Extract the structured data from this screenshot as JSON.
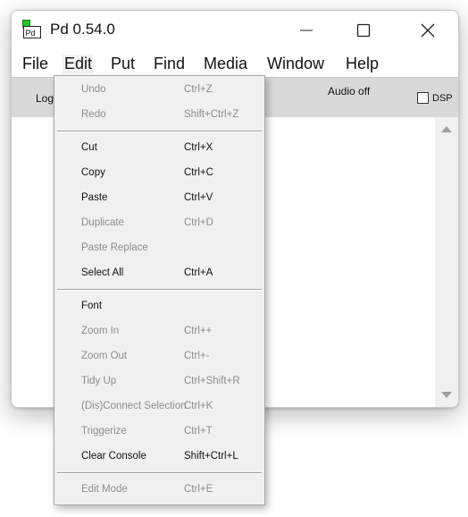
{
  "window": {
    "title": "Pd 0.54.0",
    "icon_text": "Pd",
    "controls": [
      "minimize-icon",
      "maximize-icon",
      "close-icon"
    ]
  },
  "menubar": {
    "items": [
      "File",
      "Edit",
      "Put",
      "Find",
      "Media",
      "Window",
      "Help"
    ],
    "active": "Edit"
  },
  "toolbar": {
    "log_label": "Log:",
    "audio_status": "Audio off",
    "dsp_label": "DSP",
    "dsp_checked": false
  },
  "edit_menu": {
    "items": [
      {
        "label": "Undo",
        "shortcut": "Ctrl+Z",
        "enabled": false
      },
      {
        "label": "Redo",
        "shortcut": "Shift+Ctrl+Z",
        "enabled": false
      },
      {
        "label": "Cut",
        "shortcut": "Ctrl+X",
        "enabled": true
      },
      {
        "label": "Copy",
        "shortcut": "Ctrl+C",
        "enabled": true
      },
      {
        "label": "Paste",
        "shortcut": "Ctrl+V",
        "enabled": true
      },
      {
        "label": "Duplicate",
        "shortcut": "Ctrl+D",
        "enabled": false
      },
      {
        "label": "Paste Replace",
        "shortcut": "",
        "enabled": false
      },
      {
        "label": "Select All",
        "shortcut": "Ctrl+A",
        "enabled": true
      },
      {
        "label": "Font",
        "shortcut": "",
        "enabled": true
      },
      {
        "label": "Zoom In",
        "shortcut": "Ctrl++",
        "enabled": false
      },
      {
        "label": "Zoom Out",
        "shortcut": "Ctrl+-",
        "enabled": false
      },
      {
        "label": "Tidy Up",
        "shortcut": "Ctrl+Shift+R",
        "enabled": false
      },
      {
        "label": "(Dis)Connect Selection",
        "shortcut": "Ctrl+K",
        "enabled": false
      },
      {
        "label": "Triggerize",
        "shortcut": "Ctrl+T",
        "enabled": false
      },
      {
        "label": "Clear Console",
        "shortcut": "Shift+Ctrl+L",
        "enabled": true
      },
      {
        "label": "Edit Mode",
        "shortcut": "Ctrl+E",
        "enabled": false
      }
    ]
  },
  "colors": {
    "toolbar_bg": "#d9d9d9",
    "menu_bg": "#f0f0f0",
    "disabled_text": "#8c8c8c",
    "icon_green": "#2fbf2f"
  }
}
